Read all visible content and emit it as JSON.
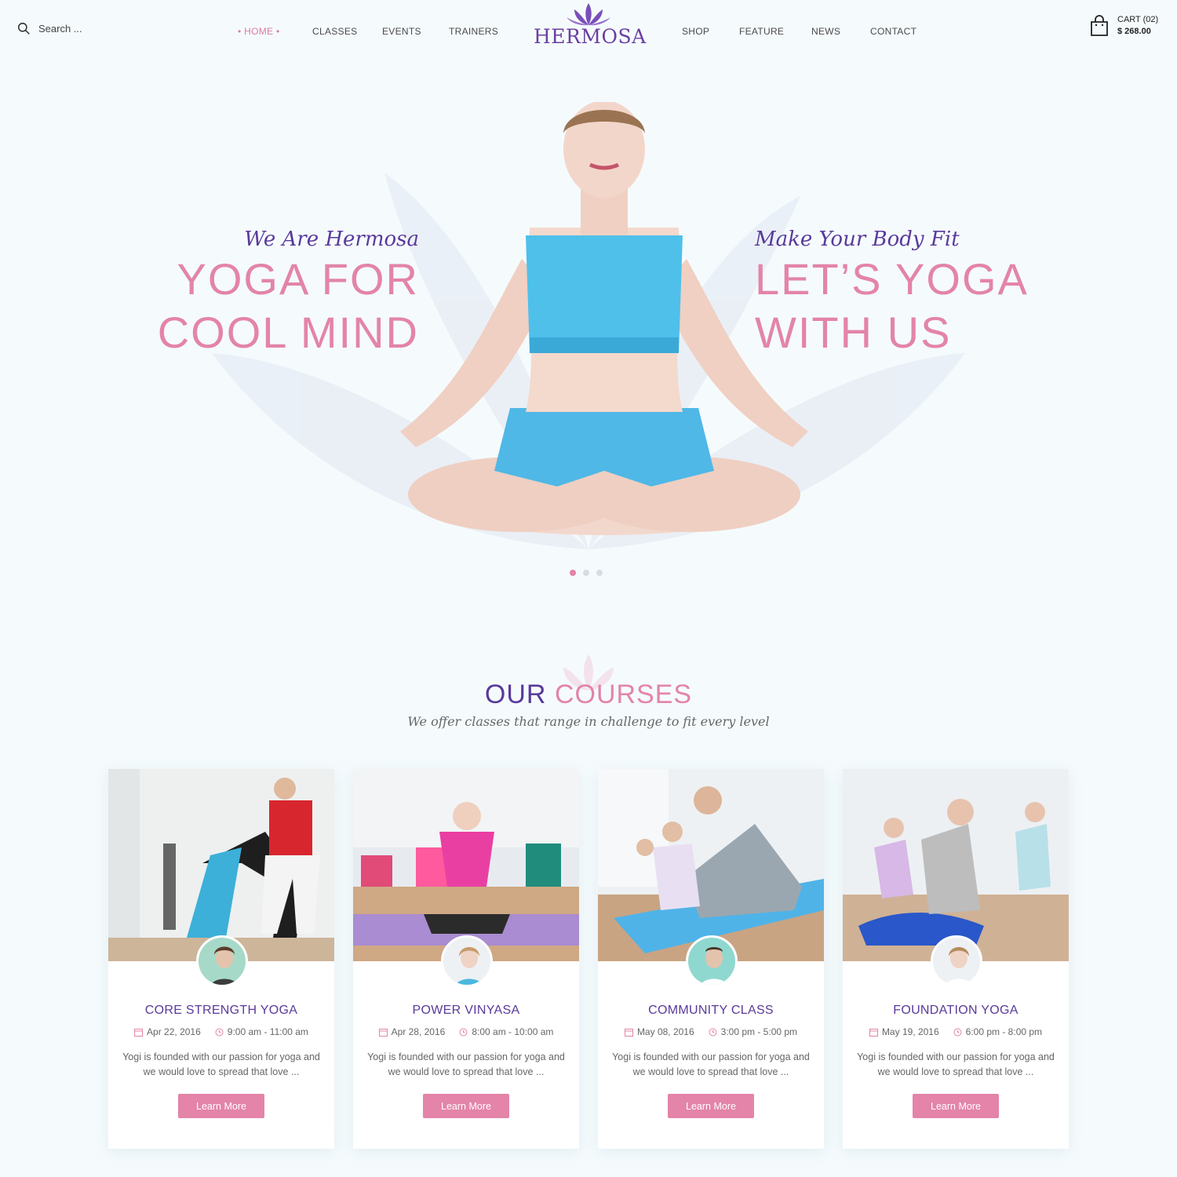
{
  "search": {
    "placeholder": "Search ..."
  },
  "nav": {
    "items": [
      "HOME",
      "CLASSES",
      "EVENTS",
      "TRAINERS",
      "SHOP",
      "FEATURE",
      "NEWS",
      "CONTACT"
    ],
    "active": "HOME"
  },
  "logo": {
    "text": "HERMOSA"
  },
  "cart": {
    "label": "CART (02)",
    "total": "$ 268.00"
  },
  "hero": {
    "left": {
      "script": "We Are Hermosa",
      "line1": "YOGA FOR",
      "line2": "COOL MIND"
    },
    "right": {
      "script": "Make Your Body Fit",
      "line1": "LET’S YOGA",
      "line2": "WITH US"
    },
    "slides": 3,
    "active_slide": 1
  },
  "courses": {
    "title_part1": "OUR",
    "title_part2": "COURSES",
    "subtitle": "We offer classes that range in challenge to fit every level",
    "items": [
      {
        "title": "CORE STRENGTH YOGA",
        "date": "Apr 22, 2016",
        "time": "9:00 am - 11:00 am",
        "desc": "Yogi is founded with our passion for yoga and we would love to spread that love ...",
        "button": "Learn More"
      },
      {
        "title": "POWER VINYASA",
        "date": "Apr 28, 2016",
        "time": "8:00 am - 10:00 am",
        "desc": "Yogi is founded with our passion for yoga and we would love to spread that love ...",
        "button": "Learn More"
      },
      {
        "title": "COMMUNITY CLASS",
        "date": "May 08, 2016",
        "time": "3:00 pm - 5:00 pm",
        "desc": "Yogi is founded with our passion for yoga and we would love to spread that love ...",
        "button": "Learn More"
      },
      {
        "title": "FOUNDATION YOGA",
        "date": "May 19, 2016",
        "time": "6:00 pm - 8:00 pm",
        "desc": "Yogi is founded with our passion for yoga and we would love to spread that love ...",
        "button": "Learn More"
      }
    ]
  },
  "colors": {
    "accent": "#e384a8",
    "brand": "#5a3a9a",
    "background": "#f5fbfd"
  }
}
